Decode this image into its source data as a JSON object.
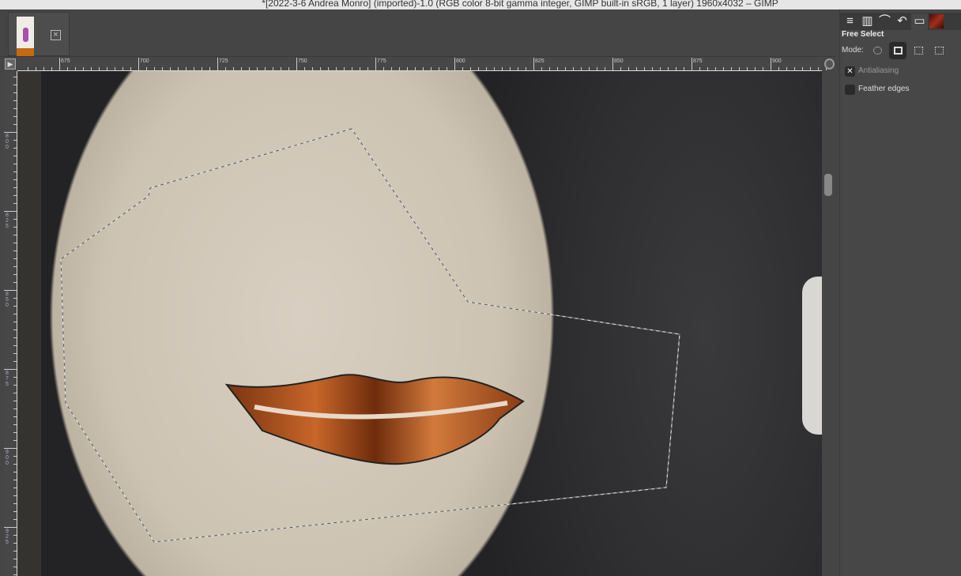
{
  "window": {
    "title": "*[2022-3-6 Andrea Monro] (imported)-1.0 (RGB color 8-bit gamma integer, GIMP built-in sRGB, 1 layer) 1960x4032 – GIMP"
  },
  "image_tab": {
    "close_icon": "close-icon"
  },
  "rulers": {
    "horizontal": [
      "675",
      "700",
      "725",
      "750",
      "775",
      "800",
      "825",
      "850",
      "875",
      "900"
    ],
    "vertical": [
      "800",
      "825",
      "850",
      "875",
      "900",
      "925"
    ]
  },
  "tool_options": {
    "dock_tabs": [
      "layers-icon",
      "channels-icon",
      "paths-icon",
      "undo-icon",
      "tool-options-icon",
      "brush-icon"
    ],
    "tool_name": "Free Select",
    "mode_label": "Mode:",
    "antialiasing": {
      "label": "Antialiasing",
      "checked": true,
      "mark": "✕"
    },
    "feather_edges": {
      "label": "Feather edges",
      "checked": false
    }
  }
}
